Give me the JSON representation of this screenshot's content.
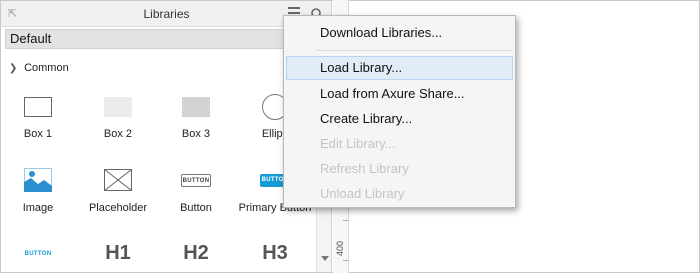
{
  "panel": {
    "title": "Libraries",
    "collapse_icon": "collapse-arrow-icon",
    "menu_icon": "hamburger-menu-icon",
    "search_icon": "search-icon",
    "selected_library": "Default"
  },
  "section": {
    "title": "Common",
    "toggle_icon": "chevron-down-icon"
  },
  "widgets": {
    "box1": "Box 1",
    "box2": "Box 2",
    "box3": "Box 3",
    "ellipse": "Ellips",
    "image": "Image",
    "placeholder": "Placeholder",
    "button": "Button",
    "primary_button": "Primary Button",
    "button_glyph_text": "BUTTON",
    "h1": "H1",
    "h2": "H2",
    "h3": "H3"
  },
  "ruler": {
    "label": "400"
  },
  "context_menu": {
    "items": [
      {
        "label": "Download Libraries...",
        "enabled": true
      },
      {
        "label": "Load Library...",
        "enabled": true,
        "highlighted": true
      },
      {
        "label": "Load from Axure Share...",
        "enabled": true
      },
      {
        "label": "Create Library...",
        "enabled": true
      },
      {
        "label": "Edit Library...",
        "enabled": false
      },
      {
        "label": "Refresh Library",
        "enabled": false
      },
      {
        "label": "Unload Library",
        "enabled": false
      }
    ]
  },
  "colors": {
    "primary_button": "#169bd5",
    "menu_highlight": "#e1ecf7",
    "disabled_text": "#c4c4c4"
  }
}
